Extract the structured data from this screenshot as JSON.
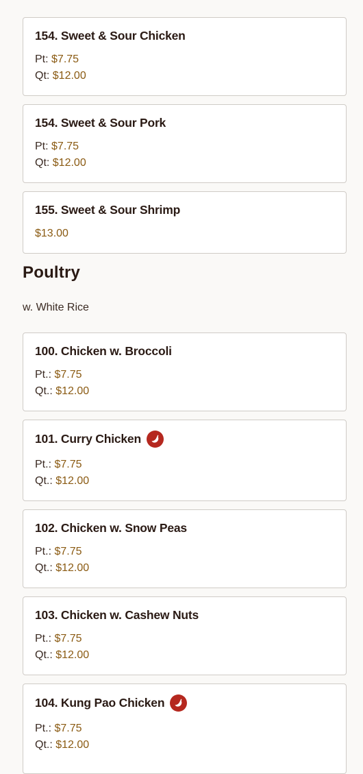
{
  "top_items": [
    {
      "title": "154. Sweet & Sour Chicken",
      "prices": [
        {
          "label": "Pt: ",
          "amount": "$7.75"
        },
        {
          "label": "Qt: ",
          "amount": "$12.00"
        }
      ]
    },
    {
      "title": "154. Sweet & Sour Pork",
      "prices": [
        {
          "label": "Pt: ",
          "amount": "$7.75"
        },
        {
          "label": "Qt: ",
          "amount": "$12.00"
        }
      ]
    },
    {
      "title": "155. Sweet & Sour Shrimp",
      "prices": [
        {
          "label": "",
          "amount": "$13.00"
        }
      ]
    }
  ],
  "section": {
    "title": "Poultry",
    "subtitle": "w. White Rice"
  },
  "poultry_items": [
    {
      "title": "100. Chicken w. Broccoli",
      "spicy": false,
      "prices": [
        {
          "label": "Pt.: ",
          "amount": "$7.75"
        },
        {
          "label": "Qt.: ",
          "amount": "$12.00"
        }
      ]
    },
    {
      "title": "101. Curry Chicken",
      "spicy": true,
      "prices": [
        {
          "label": "Pt.: ",
          "amount": "$7.75"
        },
        {
          "label": "Qt.: ",
          "amount": "$12.00"
        }
      ]
    },
    {
      "title": "102. Chicken w. Snow Peas",
      "spicy": false,
      "prices": [
        {
          "label": "Pt.: ",
          "amount": "$7.75"
        },
        {
          "label": "Qt.: ",
          "amount": "$12.00"
        }
      ]
    },
    {
      "title": "103. Chicken w. Cashew Nuts",
      "spicy": false,
      "prices": [
        {
          "label": "Pt.: ",
          "amount": "$7.75"
        },
        {
          "label": "Qt.: ",
          "amount": "$12.00"
        }
      ]
    },
    {
      "title": "104. Kung Pao Chicken",
      "spicy": true,
      "prices": [
        {
          "label": "Pt.: ",
          "amount": "$7.75"
        },
        {
          "label": "Qt.: ",
          "amount": "$12.00"
        }
      ]
    }
  ],
  "icons": {
    "spicy": "chili-pepper-icon"
  },
  "colors": {
    "price": "#8a5a12",
    "spicy": "#b5281f",
    "border": "#cfcbc6"
  }
}
